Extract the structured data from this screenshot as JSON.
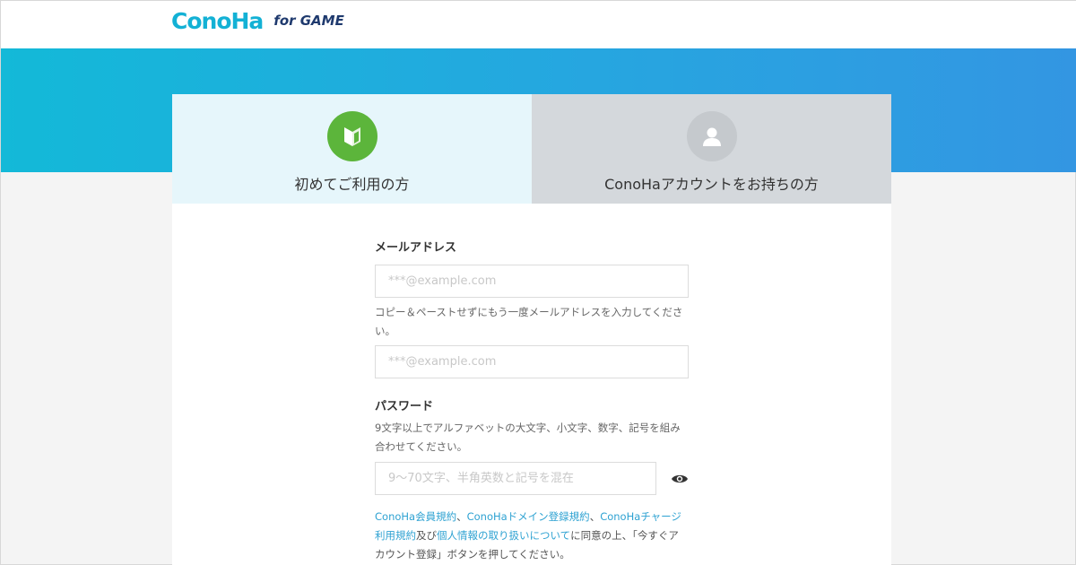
{
  "header": {
    "logo_main": "ConoHa",
    "logo_sub": "for GAME"
  },
  "tabs": [
    {
      "label": "初めてご利用の方",
      "icon": "beginner-mark-icon",
      "active": true
    },
    {
      "label": "ConoHaアカウントをお持ちの方",
      "icon": "user-icon",
      "active": false
    }
  ],
  "form": {
    "email_label": "メールアドレス",
    "email_placeholder": "***@example.com",
    "email_confirm_help": "コピー＆ペーストせずにもう一度メールアドレスを入力してください。",
    "email_confirm_placeholder": "***@example.com",
    "password_label": "パスワード",
    "password_help": "9文字以上でアルファベットの大文字、小文字、数字、記号を組み合わせてください。",
    "password_placeholder": "9～70文字、半角英数と記号を混在",
    "terms": {
      "link1": "ConoHa会員規約",
      "sep1": "、",
      "link2": "ConoHaドメイン登録規約",
      "sep2": "、",
      "link3": "ConoHaチャージ利用規約",
      "and": "及び",
      "link4": "個人情報の取り扱いについて",
      "tail": "に同意の上、「今すぐアカウント登録」ボタンを押してください。"
    }
  },
  "colors": {
    "brand": "#13b1d5",
    "hero_start": "#13b9d8",
    "hero_end": "#3396e2",
    "beginner_green": "#5cb53b",
    "link": "#2ea2d2"
  }
}
